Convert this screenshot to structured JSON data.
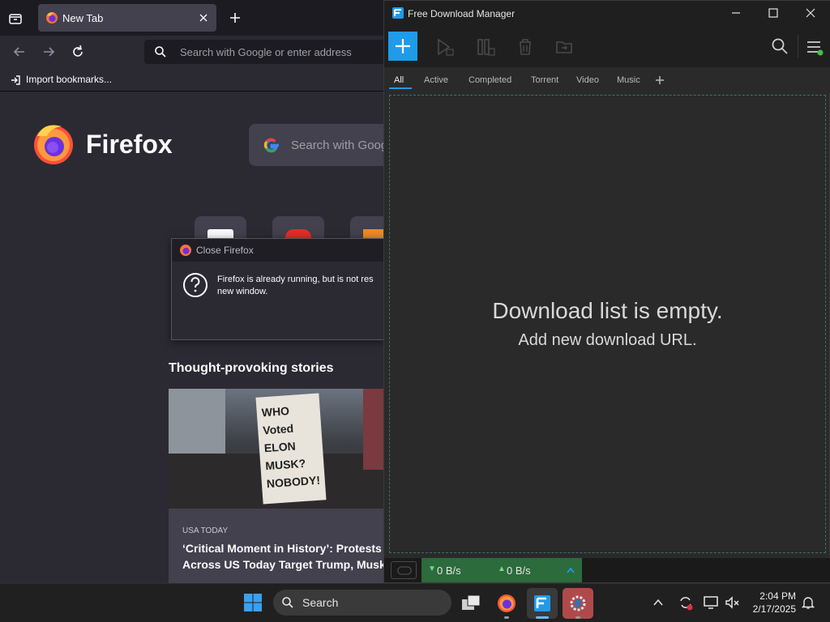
{
  "firefox": {
    "tab_title": "New Tab",
    "urlbar_placeholder": "Search with Google or enter address",
    "bookmarks_bar": {
      "import_label": "Import bookmarks..."
    },
    "brand": "Firefox",
    "content_search_placeholder": "Search with Goog",
    "dialog": {
      "title": "Close Firefox",
      "message_line1": "Firefox is already running, but is not res",
      "message_line2": "new window."
    },
    "stories": {
      "heading": "Thought-provoking stories",
      "source": "USA TODAY",
      "headline_line1": "‘Critical Moment in History’: Protests",
      "headline_line2": "Across US Today Target Trump, Musk",
      "sign_text": "WHO Voted ELON MUSK? NOBODY!"
    }
  },
  "fdm": {
    "window_title": "Free Download Manager",
    "tabs": [
      "All",
      "Active",
      "Completed",
      "Torrent",
      "Video",
      "Music"
    ],
    "active_tab": "All",
    "empty_title": "Download list is empty.",
    "empty_subtitle": "Add new download URL.",
    "download_speed": "0 B/s",
    "upload_speed": "0 B/s",
    "colors": {
      "accent": "#1e9bea",
      "status_green": "#2c6b3b"
    }
  },
  "taskbar": {
    "search_label": "Search",
    "time": "2:04 PM",
    "date": "2/17/2025"
  }
}
